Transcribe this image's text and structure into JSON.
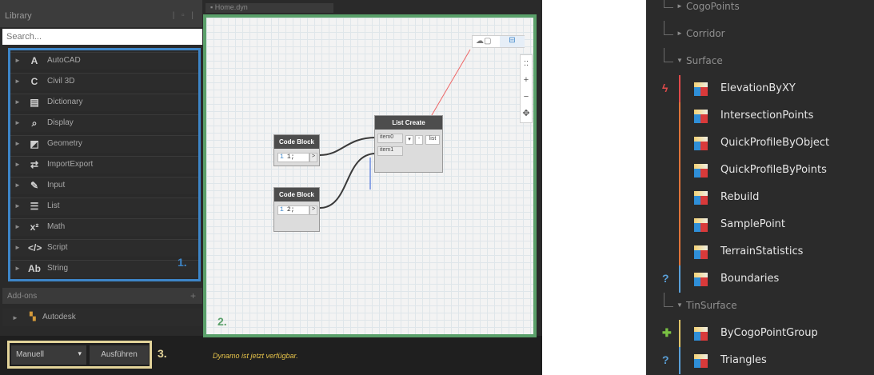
{
  "library": {
    "title": "Library",
    "search_placeholder": "Search...",
    "items": [
      {
        "label": "AutoCAD",
        "icon": "A"
      },
      {
        "label": "Civil 3D",
        "icon": "C"
      },
      {
        "label": "Dictionary",
        "icon": "▤"
      },
      {
        "label": "Display",
        "icon": "⌕"
      },
      {
        "label": "Geometry",
        "icon": "◩"
      },
      {
        "label": "ImportExport",
        "icon": "⇄"
      },
      {
        "label": "Input",
        "icon": "✎"
      },
      {
        "label": "List",
        "icon": "☰"
      },
      {
        "label": "Math",
        "icon": "x²"
      },
      {
        "label": "Script",
        "icon": "</>"
      },
      {
        "label": "String",
        "icon": "Ab"
      }
    ],
    "marker": "1.",
    "addons_label": "Add-ons",
    "autodesk_label": "Autodesk"
  },
  "toolbar": {
    "mode_label": "Manuell",
    "run_label": "Ausführen",
    "marker": "3."
  },
  "status_text": "Dynamo ist jetzt verfügbar.",
  "canvas": {
    "marker": "2.",
    "nodes": {
      "code_block_1": {
        "title": "Code Block",
        "line": "1",
        "code": "1;",
        "out": ">"
      },
      "code_block_2": {
        "title": "Code Block",
        "line": "1",
        "code": "2;",
        "out": ">"
      },
      "list_create": {
        "title": "List Create",
        "input_0": "item0",
        "input_1": "item1",
        "output": "list",
        "add": "▾",
        "remove": "-"
      }
    },
    "zoom_controls": [
      ":: ",
      "+",
      "−",
      "✥"
    ]
  },
  "tree": {
    "rows": [
      {
        "type": "group",
        "label": "CogoPoints"
      },
      {
        "type": "group",
        "label": "Corridor"
      },
      {
        "type": "group",
        "label": "Surface",
        "expanded": true
      },
      {
        "type": "node",
        "label": "ElevationByXY",
        "mark": "ϟ",
        "mark_color": "#e04a4a",
        "bar_color": "#e04a4a"
      },
      {
        "type": "node",
        "label": "IntersectionPoints",
        "mark": "",
        "bar_color": "#e0743a"
      },
      {
        "type": "node",
        "label": "QuickProfileByObject",
        "mark": "",
        "bar_color": "#e0743a"
      },
      {
        "type": "node",
        "label": "QuickProfileByPoints",
        "mark": "",
        "bar_color": "#e0743a"
      },
      {
        "type": "node",
        "label": "Rebuild",
        "mark": "",
        "bar_color": "#e0743a"
      },
      {
        "type": "node",
        "label": "SamplePoint",
        "mark": "",
        "bar_color": "#e0743a"
      },
      {
        "type": "node",
        "label": "TerrainStatistics",
        "mark": "",
        "bar_color": "#e0743a"
      },
      {
        "type": "node",
        "label": "Boundaries",
        "mark": "?",
        "mark_color": "#5aa0d8",
        "bar_color": "#5aa0d8"
      },
      {
        "type": "group",
        "label": "TinSurface",
        "expanded": true
      },
      {
        "type": "node",
        "label": "ByCogoPointGroup",
        "mark": "✚",
        "mark_color": "#7ac143",
        "bar_color": "#e0c46a"
      },
      {
        "type": "node",
        "label": "Triangles",
        "mark": "?",
        "mark_color": "#5aa0d8",
        "bar_color": "#5aa0d8"
      }
    ]
  }
}
